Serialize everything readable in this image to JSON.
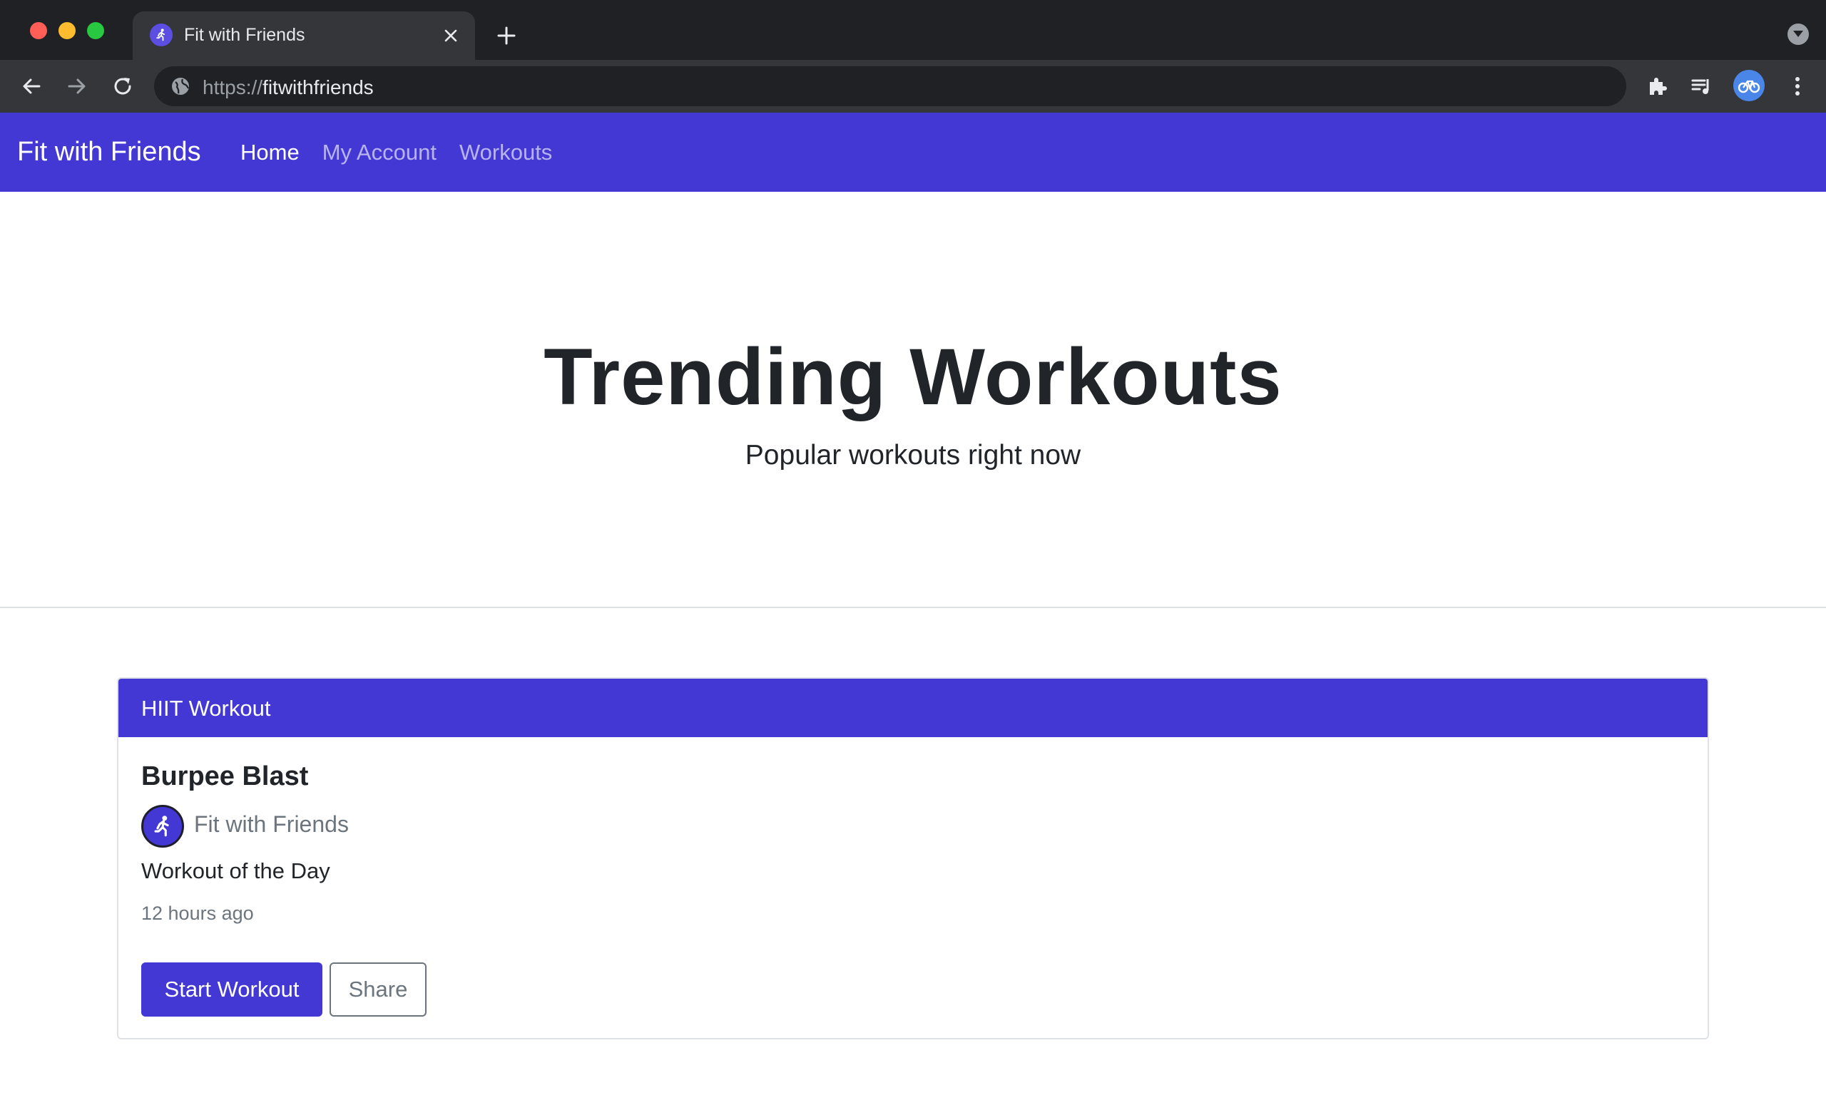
{
  "browser": {
    "tab": {
      "title": "Fit with Friends",
      "favicon": "runner-icon"
    },
    "address": {
      "scheme": "https://",
      "host": "fitwithfriends"
    }
  },
  "navbar": {
    "brand": "Fit with Friends",
    "links": [
      {
        "label": "Home",
        "active": true
      },
      {
        "label": "My Account",
        "active": false
      },
      {
        "label": "Workouts",
        "active": false
      }
    ]
  },
  "hero": {
    "title": "Trending Workouts",
    "subtitle": "Popular workouts right now"
  },
  "card": {
    "header": "HIIT Workout",
    "title": "Burpee Blast",
    "author": "Fit with Friends",
    "subtitle": "Workout of the Day",
    "time": "12 hours ago",
    "primary_button": "Start Workout",
    "secondary_button": "Share"
  },
  "colors": {
    "brand": "#4338d4",
    "text": "#212529",
    "muted": "#6c757d",
    "chrome_dark": "#202124",
    "chrome_toolbar": "#35363a"
  }
}
